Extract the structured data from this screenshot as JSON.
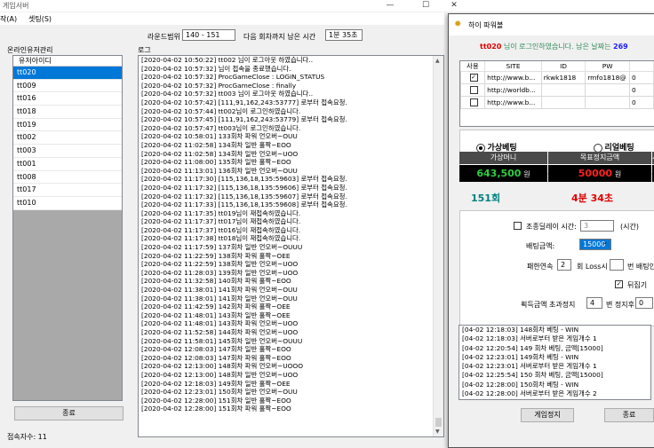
{
  "main_window": {
    "title": "게임서버",
    "menu": [
      "작(A)",
      "셋팅(S)"
    ],
    "round_range_label": "라운드범위",
    "round_range_value": "140 - 151",
    "next_round_label": "다음 회차까지 남은 시간",
    "next_round_value": "1분 35초",
    "online_users_label": "온라인유저관리",
    "log_label": "로그",
    "user_list_header": "유저아이디",
    "users": [
      "tt020",
      "tt009",
      "tt016",
      "tt018",
      "tt019",
      "tt002",
      "tt003",
      "tt001",
      "tt008",
      "tt017",
      "tt010"
    ],
    "end_button": "종료",
    "connected_label": "접속자수: 11",
    "log_lines": [
      "[2020-04-02 10:50:22] tt002 님이 로그아웃 하였습니다..",
      "[2020-04-02 10:57:32] 님이 접속을 종료했습니다.",
      "[2020-04-02 10:57:32] ProcGameClose : LOGIN_STATUS",
      "[2020-04-02 10:57:32] ProcGameClose : finally",
      "[2020-04-02 10:57:32] tt003 님이 로그아웃 하였습니다..",
      "[2020-04-02 10:57:42] [111,91,162,243:53777] 로부터 접속요청.",
      "[2020-04-02 10:57:44] tt002님이 로그인하였습니다.",
      "[2020-04-02 10:57:45] [111,91,162,243:53779] 로부터 접속요청.",
      "[2020-04-02 10:57:47] tt003님이 로그인하였습니다.",
      "[2020-04-02 10:58:01] 133회차 파워 언오버~OUU",
      "[2020-04-02 11:02:58] 134회차 일반 홀짝~EOO",
      "[2020-04-02 11:02:58] 134회차 일반 언오버~UOO",
      "[2020-04-02 11:08:00] 135회차 일반 홀짝~EOO",
      "[2020-04-02 11:13:01] 136회차 일반 언오버~OUU",
      "[2020-04-02 11:17:30] [115,136,18,135:59603] 로부터 접속요청.",
      "[2020-04-02 11:17:32] [115,136,18,135:59606] 로부터 접속요청.",
      "[2020-04-02 11:17:32] [115,136,18,135:59607] 로부터 접속요청.",
      "[2020-04-02 11:17:33] [115,136,18,135:59608] 로부터 접속요청.",
      "[2020-04-02 11:17:35] tt019님이 재접속하였습니다.",
      "[2020-04-02 11:17:37] tt017님이 재접속하였습니다.",
      "[2020-04-02 11:17:37] tt016님이 재접속하였습니다.",
      "[2020-04-02 11:17:38] tt018님이 재접속하였습니다.",
      "[2020-04-02 11:17:59] 137회차 일반 언오버~OUUU",
      "[2020-04-02 11:22:59] 138회차 파워 홀짝~OEE",
      "[2020-04-02 11:22:59] 138회차 일반 언오버~UOO",
      "[2020-04-02 11:28:03] 139회차 일반 언오버~UOO",
      "[2020-04-02 11:32:58] 140회차 파워 홀짝~EOO",
      "[2020-04-02 11:38:01] 141회차 파워 언오버~OUU",
      "[2020-04-02 11:38:01] 141회차 일반 언오버~OUU",
      "[2020-04-02 11:42:59] 142회차 파워 홀짝~OEE",
      "[2020-04-02 11:48:01] 143회차 일반 홀짝~OEE",
      "[2020-04-02 11:48:01] 143회차 파워 언오버~UOO",
      "[2020-04-02 11:52:58] 144회차 파워 언오버~UOO",
      "[2020-04-02 11:58:01] 145회차 일반 언오버~OUUU",
      "[2020-04-02 12:08:03] 147회차 일반 홀짝~EOO",
      "[2020-04-02 12:08:03] 147회차 파워 홀짝~EOO",
      "[2020-04-02 12:13:00] 148회차 파워 언오버~UOOO",
      "[2020-04-02 12:13:00] 148회차 일반 언오버~UOO",
      "[2020-04-02 12:18:03] 149회차 일반 홀짝~OEE",
      "[2020-04-02 12:23:01] 150회차 일반 언오버~OUU",
      "[2020-04-02 12:28:00] 151회차 일반 홀짝~EOO",
      "[2020-04-02 12:28:00] 151회차 파워 홀짝~EOO"
    ]
  },
  "popup": {
    "title": "하이 파워볼",
    "login_user": "tt020",
    "login_text": " 님이 로그인하였습니다. 남은 날짜는 ",
    "days_left": "269",
    "grid_headers": [
      "사용",
      "SITE",
      "ID",
      "PW",
      ""
    ],
    "grid_rows": [
      {
        "checked": true,
        "site": "http://www.b...",
        "id": "rkwk1818",
        "pw": "rmfo1818@",
        "n": "0"
      },
      {
        "checked": false,
        "site": "http://worldb...",
        "id": "",
        "pw": "",
        "n": "0"
      },
      {
        "checked": false,
        "site": "http://www.b...",
        "id": "",
        "pw": "",
        "n": "0"
      }
    ],
    "virtual_bet_label": "가상베팅",
    "real_bet_label": "리얼베팅",
    "virtual_money_label": "가상머니",
    "virtual_money_value": "643,500",
    "won1": "원",
    "target_amount_label": "목표정지금액",
    "target_amount_value": "50000",
    "won2": "원",
    "extra_col_label": "시",
    "round_value": "151회",
    "time_minutes": "4분",
    "time_seconds": "34초",
    "delay_label": "조종딜레이 시간:",
    "delay_value": "3",
    "delay_unit": "(시간)",
    "bet_amount_label": "배팅금액:",
    "bet_amount_value": "15000",
    "loss_label1": "패한연속",
    "loss_value": "2",
    "loss_label2": "회 Loss시",
    "bet_label_right": "번 배팅안",
    "flip_label": "뒤집기",
    "profit_label": "획득금액 초과정지",
    "profit_value": "4",
    "stop_label": "변 정지후",
    "stop_value": "0",
    "messages": [
      "[04-02 12:18:03] 148회차 베팅 - WIN",
      "[04-02 12:18:03] 서버로부터 받은 게임개수 1",
      "[04-02 12:20:54]  149 회차 베팅, 금액[15000]",
      "[04-02 12:23:01] 149회차 베팅 - WIN",
      "[04-02 12:23:01] 서버로부터 받은 게임개수 1",
      "[04-02 12:25:54]  150 회차 베팅, 금액[15000]",
      "[04-02 12:28:00] 150회차 베팅 - WIN",
      "[04-02 12:28:00] 서버로부터 받은 게임개수 2"
    ],
    "stop_button": "게임정지",
    "end_button": "종료"
  },
  "colors": {
    "accent_blue": "#0078d7",
    "money_green": "#2ecc40",
    "target_red": "#ff2020",
    "round_teal": "#008080",
    "time_red": "#e00000",
    "days_blue": "#1a1aff"
  }
}
